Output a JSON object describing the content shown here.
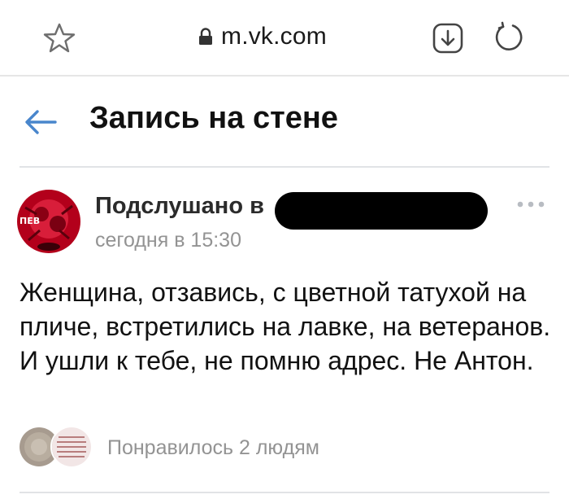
{
  "browser": {
    "url": "m.vk.com",
    "icons": [
      "star-icon",
      "lock-icon",
      "download-icon",
      "reload-icon"
    ]
  },
  "header": {
    "title": "Запись на стене",
    "back_icon": "arrow-left-icon"
  },
  "post": {
    "author": "Подслушано в",
    "avatar_text": "ПЕВ",
    "time": "сегодня в 15:30",
    "text": "Женщина, отзавись, с цветной татухой на пличе, встретились на лавке, на ветеранов. И ушли к тебе, не помню адрес. Не Антон.",
    "more_icon": "more-dots-icon",
    "likes_text": "Понравилось 2 людям"
  },
  "colors": {
    "accent": "#4986cc",
    "muted_text": "#939393",
    "avatar_red": "#c8102e"
  }
}
